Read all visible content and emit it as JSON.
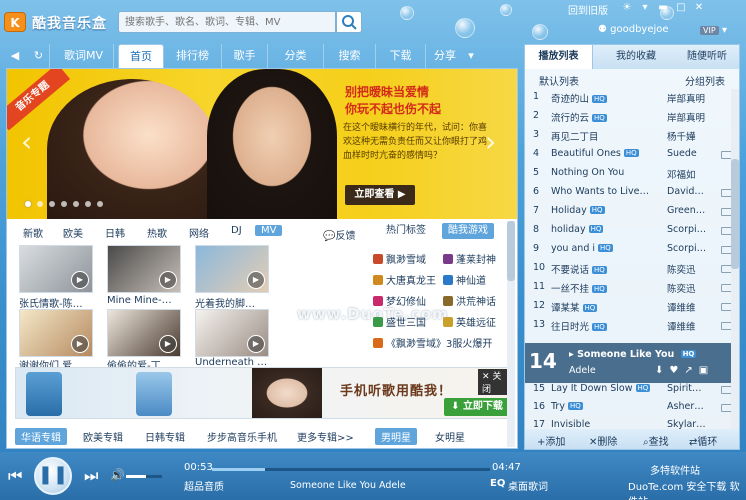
{
  "app": {
    "logo_text": "K",
    "title": "酷我音乐盒",
    "back_old": "回到旧版",
    "username": "goodbyejoe",
    "vip": "VIP"
  },
  "search": {
    "placeholder": "搜索歌手、歌名、歌词、专辑、MV"
  },
  "nav": {
    "tabs": [
      "歌词MV",
      "首页",
      "排行榜",
      "歌手",
      "分类",
      "搜索",
      "下载",
      "分享"
    ],
    "active": "首页"
  },
  "banner": {
    "ribbon": "音乐专题",
    "headline1": "别把暧昧当爱情",
    "headline2": "你玩不起也伤不起",
    "desc": "在这个暧昧横行的年代，试问：你喜欢这种无需负责任而又让你眼打了鸡血样时时亢奋的感情吗？",
    "button": "立即查看 ▶"
  },
  "categories": [
    "新歌",
    "欧美",
    "日韩",
    "热歌",
    "网络",
    "DJ",
    "MV"
  ],
  "category_active": "MV",
  "feedback": "反馈",
  "videos": [
    {
      "label": "张氏情歌-陈…"
    },
    {
      "label": "Mine Mine-…"
    },
    {
      "label": "光着我的脚…"
    },
    {
      "label": "谢谢你们 爱…"
    },
    {
      "label": "偷偷的爱-丁…"
    },
    {
      "label": "Underneath …"
    }
  ],
  "hot": {
    "tabs": [
      "热门标签",
      "酷我游戏"
    ],
    "active": "酷我游戏",
    "games": [
      "飘渺雪域",
      "蓬莱封神",
      "大唐真龙王",
      "神仙道",
      "梦幻修仙",
      "洪荒神话",
      "盛世三国",
      "英雄远征",
      "《飘渺雪域》3服火爆开"
    ]
  },
  "ad": {
    "text": "手机听歌用酷我！",
    "close": "关闭",
    "button": "立即下载"
  },
  "bottom_tabs": [
    "华语专辑",
    "欧美专辑",
    "日韩专辑",
    "步步高音乐手机",
    "更多专辑>>",
    "男明星",
    "女明星"
  ],
  "bottom_active": [
    "华语专辑",
    "男明星"
  ],
  "watermark_center": "www.DuoTe.com",
  "playlist": {
    "tabs": [
      "播放列表",
      "我的收藏",
      "随便听听"
    ],
    "active": "播放列表",
    "sub_default": "默认列表",
    "sub_group": "分组列表",
    "songs": [
      {
        "num": "1",
        "title": "奇迹的山",
        "hq": true,
        "artist": "岸部真明",
        "mv": false
      },
      {
        "num": "2",
        "title": "流行的云",
        "hq": true,
        "artist": "岸部真明",
        "mv": false
      },
      {
        "num": "3",
        "title": "再见二丁目",
        "hq": false,
        "artist": "杨千嬅",
        "mv": false
      },
      {
        "num": "4",
        "title": "Beautiful Ones",
        "hq": true,
        "artist": "Suede",
        "mv": true
      },
      {
        "num": "5",
        "title": "Nothing On You",
        "hq": false,
        "artist": "邓福如",
        "mv": false
      },
      {
        "num": "6",
        "title": "Who Wants to Live…",
        "hq": false,
        "artist": "David…",
        "mv": true
      },
      {
        "num": "7",
        "title": "Holiday",
        "hq": true,
        "artist": "Green…",
        "mv": true
      },
      {
        "num": "8",
        "title": "holiday",
        "hq": true,
        "artist": "Scorpi…",
        "mv": true
      },
      {
        "num": "9",
        "title": "you and i",
        "hq": true,
        "artist": "Scorpi…",
        "mv": true
      },
      {
        "num": "10",
        "title": "不要说话",
        "hq": true,
        "artist": "陈奕迅",
        "mv": true
      },
      {
        "num": "11",
        "title": "一丝不挂",
        "hq": true,
        "artist": "陈奕迅",
        "mv": true
      },
      {
        "num": "12",
        "title": "谭某某",
        "hq": true,
        "artist": "谭维维",
        "mv": true
      },
      {
        "num": "13",
        "title": "往日时光",
        "hq": true,
        "artist": "谭维维",
        "mv": true
      }
    ],
    "now_playing": {
      "num": "14",
      "title": "Someone Like You",
      "hq": true,
      "artist": "Adele"
    },
    "songs_after": [
      {
        "num": "15",
        "title": "Lay It Down Slow",
        "hq": true,
        "artist": "Spirit…",
        "mv": true
      },
      {
        "num": "16",
        "title": "Try",
        "hq": true,
        "artist": "Asher…",
        "mv": true
      },
      {
        "num": "17",
        "title": "Invisible",
        "hq": false,
        "artist": "Skylar…",
        "mv": false
      }
    ],
    "footer": [
      "+添加",
      "✕删除",
      "查找",
      "循环"
    ]
  },
  "player": {
    "time_current": "00:53",
    "time_total": "04:47",
    "progress": 0.19,
    "volume": 0.55,
    "quality": "超品音质",
    "now_song": "Someone Like You Adele",
    "eq": "EQ",
    "desk_lyrics": "桌面歌词",
    "play_symbol": "❚❚"
  },
  "watermark": {
    "line1": "多特软件站",
    "line2": "DuoTe.com 安全下载 软件站"
  }
}
